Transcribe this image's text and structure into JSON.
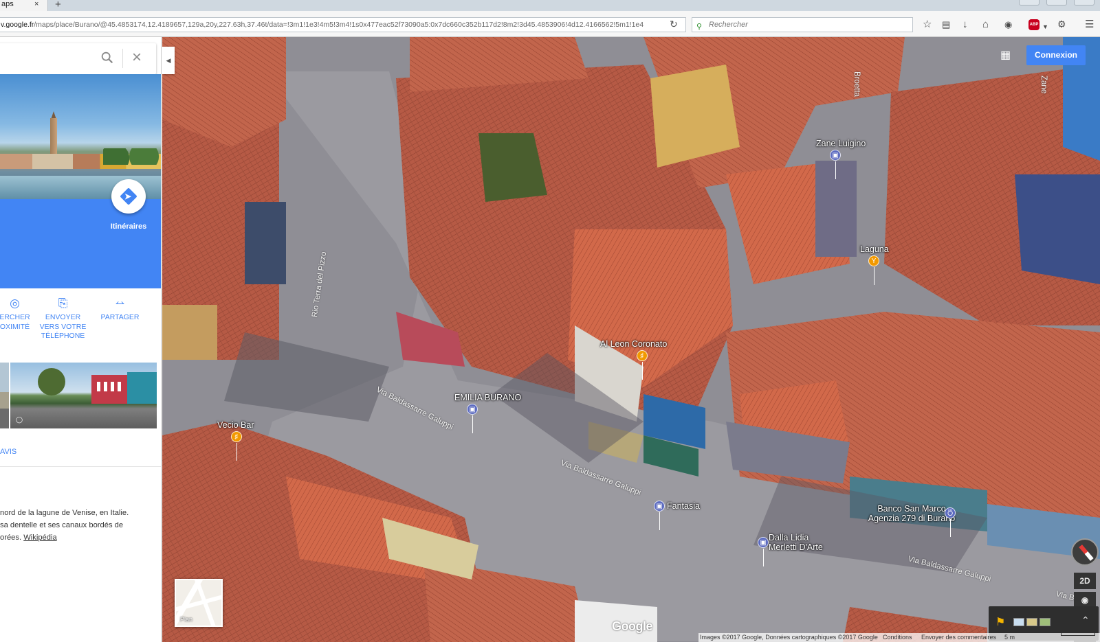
{
  "browser": {
    "tab_title": "aps",
    "tab_close": "×",
    "new_tab": "+",
    "url_host": "v.google.fr",
    "url_path": "/maps/place/Burano/@45.4853174,12.4189657,129a,20y,227.63h,37.46t/data=!3m1!1e3!4m5!3m4!1s0x477eac52f73090a5:0x7dc660c352b117d2!8m2!3d45.4853906!4d12.4166562!5m1!1e4",
    "reload_icon": "reload-icon",
    "search_placeholder": "Rechercher",
    "toolbar_icons": [
      "star-icon",
      "clipboard-icon",
      "download-icon",
      "home-icon",
      "pocket-icon",
      "abp-icon",
      "extension-icon",
      "menu-icon"
    ],
    "abp_text": "ABP"
  },
  "panel": {
    "search_value": "",
    "directions_label": "Itinéraires",
    "actions": [
      {
        "icon": "pin-icon",
        "lines": [
          "ERCHER",
          "OXIMITÉ"
        ]
      },
      {
        "icon": "phone-icon",
        "lines": [
          "ENVOYER",
          "VERS VOTRE",
          "TÉLÉPHONE"
        ]
      },
      {
        "icon": "share-icon",
        "lines": [
          "PARTAGER"
        ]
      }
    ],
    "reviews_label": "AVIS",
    "description_lines": [
      "nord de la lagune de Venise, en Italie.",
      "sa dentelle et ses canaux bordés de",
      "orées."
    ],
    "wikipedia_link": "Wikipédia",
    "collapse_arrow": "◀"
  },
  "map": {
    "signin_label": "Connexion",
    "apps_icon": "apps-grid-icon",
    "pois": [
      {
        "name": "Zane Luigino",
        "category": "shopping",
        "color": "#5c6bc0"
      },
      {
        "name": "Laguna",
        "category": "bar",
        "color": "#f29900"
      },
      {
        "name": "Al Leon Coronato",
        "category": "restaurant",
        "color": "#f29900"
      },
      {
        "name": "EMILIA BURANO",
        "category": "shopping",
        "color": "#5c6bc0"
      },
      {
        "name": "Vecio Bar",
        "category": "restaurant",
        "color": "#f29900"
      },
      {
        "name": "Fantasia",
        "category": "shopping",
        "color": "#5c6bc0"
      },
      {
        "name": "Banco San Marco\nAgenzia 279 di Burano",
        "category": "bank",
        "color": "#5c6bc0"
      },
      {
        "name": "Dalla Lidia\nMerletti D'Arte",
        "category": "shopping",
        "color": "#5c6bc0"
      }
    ],
    "streets": [
      "Via Baldassarre Galuppi",
      "Via Baldassarre Galuppi",
      "Via Baldassarre Galuppi",
      "Rio Terra del Pizzo",
      "Via Ba",
      "Broetta",
      "Zane"
    ],
    "controls": {
      "mode_2d": "2D",
      "zoom_in": "+",
      "zoom_out": "−",
      "location_icon": "my-location-icon",
      "compass_icon": "compass-icon"
    },
    "minimap_label": "Plan",
    "logo": "Google",
    "footer": {
      "imagery": "Images ©2017 Google, Données cartographiques ©2017 Google",
      "terms": "Conditions",
      "feedback": "Envoyer des commentaires",
      "scale": "5 m"
    }
  }
}
